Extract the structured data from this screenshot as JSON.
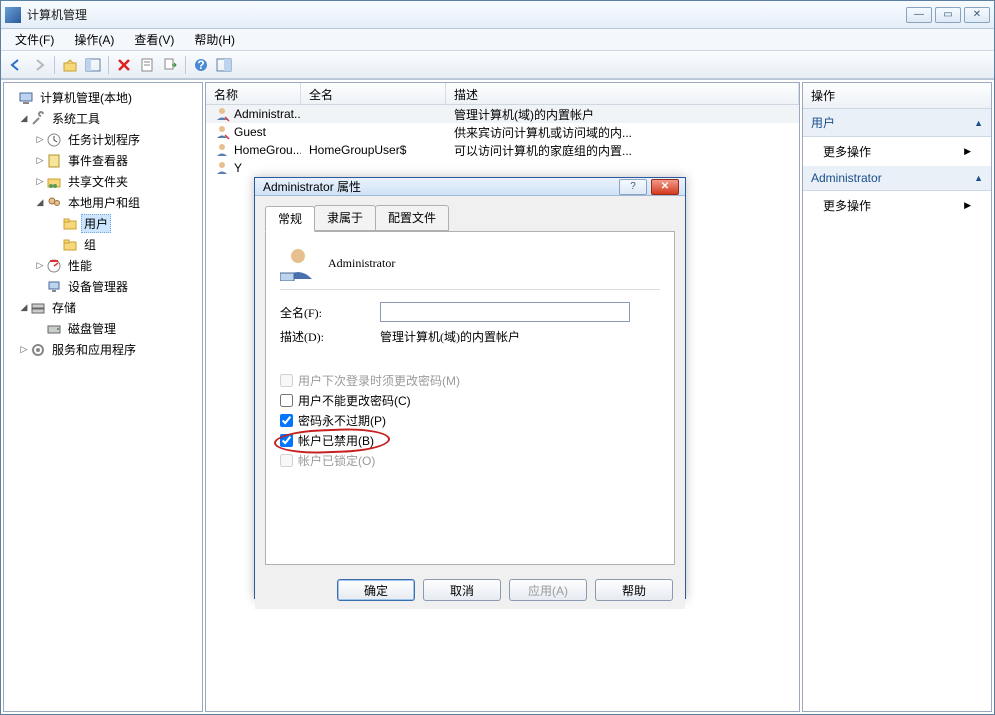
{
  "window": {
    "title": "计算机管理"
  },
  "menu": {
    "file": "文件(F)",
    "action": "操作(A)",
    "view": "查看(V)",
    "help": "帮助(H)"
  },
  "tree": {
    "root": "计算机管理(本地)",
    "sysTools": "系统工具",
    "taskSched": "任务计划程序",
    "eventViewer": "事件查看器",
    "sharedFolders": "共享文件夹",
    "localUsersGroups": "本地用户和组",
    "users": "用户",
    "groups": "组",
    "perf": "性能",
    "devMgr": "设备管理器",
    "storage": "存储",
    "diskMgmt": "磁盘管理",
    "services": "服务和应用程序"
  },
  "list": {
    "headers": {
      "name": "名称",
      "fullName": "全名",
      "description": "描述"
    },
    "rows": [
      {
        "name": "Administrat...",
        "fullName": "",
        "description": "管理计算机(域)的内置帐户"
      },
      {
        "name": "Guest",
        "fullName": "",
        "description": "供来宾访问计算机或访问域的内..."
      },
      {
        "name": "HomeGrou...",
        "fullName": "HomeGroupUser$",
        "description": "可以访问计算机的家庭组的内置..."
      },
      {
        "name": "Y",
        "fullName": "",
        "description": ""
      }
    ]
  },
  "actions": {
    "header": "操作",
    "section1": "用户",
    "more1": "更多操作",
    "section2": "Administrator",
    "more2": "更多操作"
  },
  "dialog": {
    "title": "Administrator 属性",
    "tabs": {
      "general": "常规",
      "memberOf": "隶属于",
      "profile": "配置文件"
    },
    "name": "Administrator",
    "labels": {
      "fullName": "全名(F):",
      "description": "描述(D):"
    },
    "values": {
      "fullName": "",
      "description": "管理计算机(域)的内置帐户"
    },
    "checkboxes": {
      "mustChange": "用户下次登录时须更改密码(M)",
      "cannotChange": "用户不能更改密码(C)",
      "neverExpires": "密码永不过期(P)",
      "disabled": "帐户已禁用(B)",
      "locked": "帐户已锁定(O)"
    },
    "buttons": {
      "ok": "确定",
      "cancel": "取消",
      "apply": "应用(A)",
      "help": "帮助"
    }
  }
}
